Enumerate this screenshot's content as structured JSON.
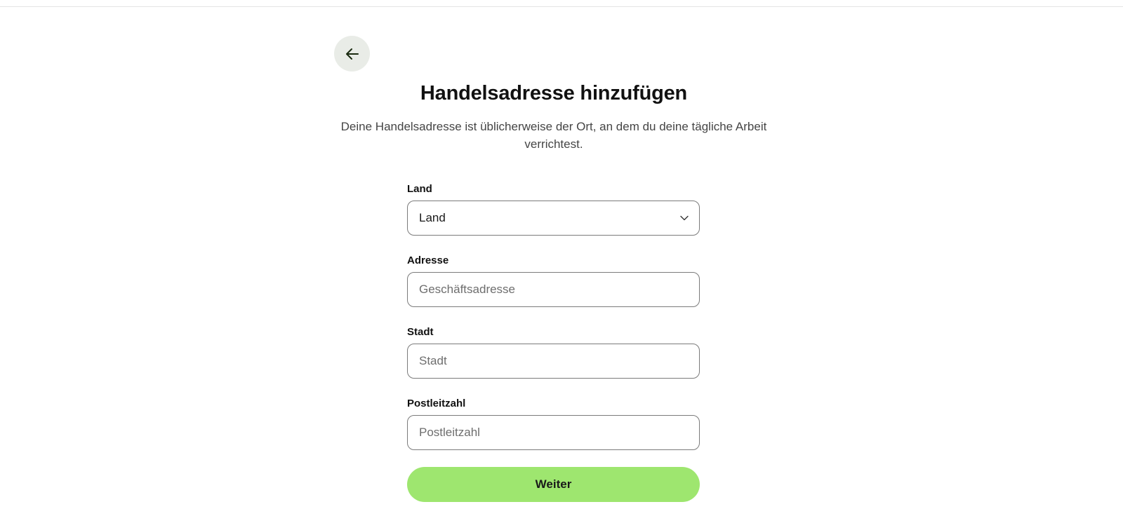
{
  "header": {
    "title": "Handelsadresse hinzufügen",
    "subtitle": "Deine Handelsadresse ist üblicherweise der Ort, an dem du deine tägliche Arbeit verrichtest."
  },
  "back_button": {
    "icon": "arrow-left-icon"
  },
  "form": {
    "country": {
      "label": "Land",
      "selected": "Land",
      "icon": "chevron-down-icon"
    },
    "address": {
      "label": "Adresse",
      "placeholder": "Geschäftsadresse",
      "value": ""
    },
    "city": {
      "label": "Stadt",
      "placeholder": "Stadt",
      "value": ""
    },
    "postal_code": {
      "label": "Postleitzahl",
      "placeholder": "Postleitzahl",
      "value": ""
    }
  },
  "actions": {
    "continue_label": "Weiter"
  },
  "colors": {
    "accent": "#9ee66f",
    "back_button_bg": "#e9ece7",
    "input_border": "#7b7b7b",
    "placeholder": "#6e6e6e"
  }
}
